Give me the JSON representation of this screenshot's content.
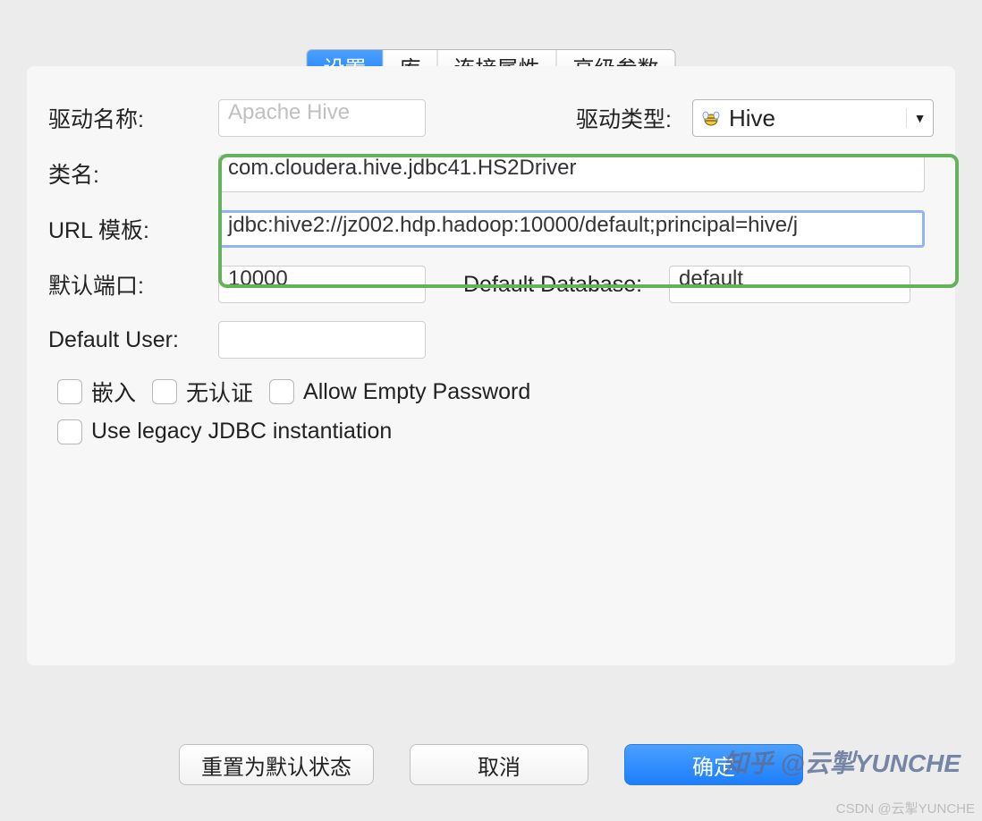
{
  "tabs": {
    "settings": "设置",
    "library": "库",
    "connection_props": "连接属性",
    "advanced": "高级参数"
  },
  "form": {
    "driver_name_label": "驱动名称:",
    "driver_name_value": "Apache Hive",
    "driver_type_label": "驱动类型:",
    "driver_type_value": "Hive",
    "class_name_label": "类名:",
    "class_name_value": "com.cloudera.hive.jdbc41.HS2Driver",
    "url_template_label": "URL 模板:",
    "url_template_value": "jdbc:hive2://jz002.hdp.hadoop:10000/default;principal=hive/j",
    "default_port_label": "默认端口:",
    "default_port_value": "10000",
    "default_database_label": "Default Database:",
    "default_database_value": "default",
    "default_user_label": "Default User:",
    "default_user_value": ""
  },
  "checkboxes": {
    "embedded": "嵌入",
    "no_auth": "无认证",
    "allow_empty_password": "Allow Empty Password",
    "use_legacy_jdbc": "Use legacy JDBC instantiation"
  },
  "buttons": {
    "reset_default": "重置为默认状态",
    "cancel": "取消",
    "ok": "确定"
  },
  "watermark": {
    "main": "知乎 @云掣YUNCHE",
    "footer": "CSDN @云掣YUNCHE"
  }
}
